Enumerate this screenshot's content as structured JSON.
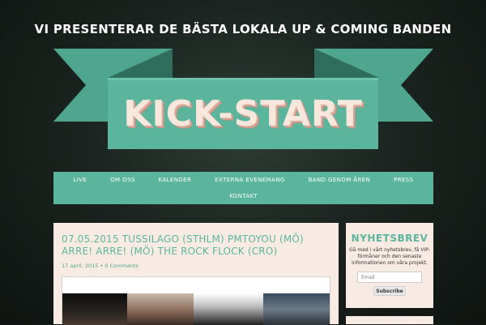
{
  "header": {
    "tagline": "VI PRESENTERAR DE BÄSTA LOKALA UP & COMING BANDEN",
    "logo_text": "KICK-START"
  },
  "nav": {
    "row1": [
      "LIVE",
      "OM OSS",
      "KALENDER",
      "EXTERNA EVENEMANG",
      "BAND GENOM ÅREN",
      "PRESS"
    ],
    "row2": [
      "KONTAKT"
    ]
  },
  "post": {
    "title": "07.05.2015 TUSSILAGO (STHLM) PMTOYOU (MÖ) ARRE! ARRE! (MÖ) THE ROCK FLOCK (CRO)",
    "date": "17 april, 2015",
    "separator": " • ",
    "comments": "0 Comments"
  },
  "newsletter": {
    "title": "NYHETSBREV",
    "text": "Gå med i vårt nyhetsbrev, få VIP-förmåner och den senaste informationen om våra projekt.",
    "email_placeholder": "Email",
    "button_label": "Subscribe"
  },
  "colors": {
    "accent": "#5bb49c",
    "accent_dark": "#3f8f7b",
    "panel": "#f7ebe4",
    "logo_text": "#f7e7dd"
  }
}
